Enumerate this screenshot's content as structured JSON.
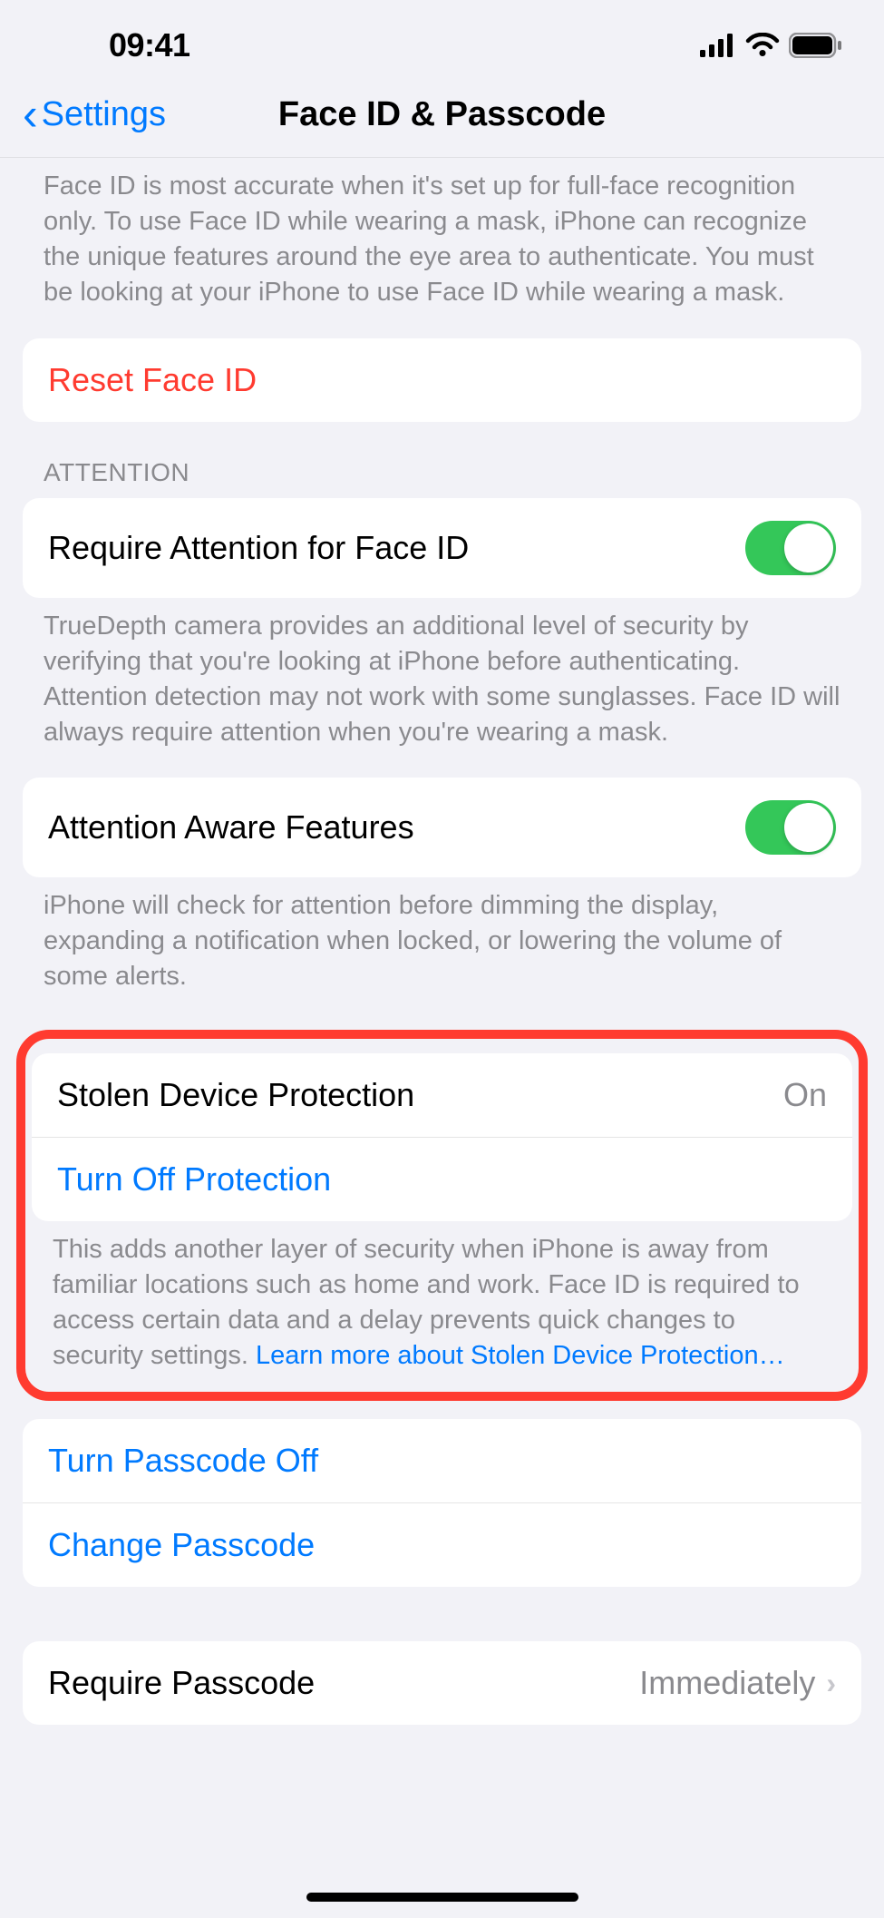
{
  "status": {
    "time": "09:41"
  },
  "nav": {
    "back_label": "Settings",
    "title": "Face ID & Passcode"
  },
  "faceid_mask_footer": "Face ID is most accurate when it's set up for full-face recognition only. To use Face ID while wearing a mask, iPhone can recognize the unique features around the eye area to authenticate. You must be looking at your iPhone to use Face ID while wearing a mask.",
  "reset_faceid": {
    "label": "Reset Face ID"
  },
  "attention": {
    "header": "ATTENTION",
    "require_label": "Require Attention for Face ID",
    "require_footer": "TrueDepth camera provides an additional level of security by verifying that you're looking at iPhone before authenticating. Attention detection may not work with some sunglasses. Face ID will always require attention when you're wearing a mask.",
    "aware_label": "Attention Aware Features",
    "aware_footer": "iPhone will check for attention before dimming the display, expanding a notification when locked, or lowering the volume of some alerts."
  },
  "stolen": {
    "label": "Stolen Device Protection",
    "value": "On",
    "turnoff_label": "Turn Off Protection",
    "footer_text": "This adds another layer of security when iPhone is away from familiar locations such as home and work. Face ID is required to access certain data and a delay prevents quick changes to security settings. ",
    "learn_more": "Learn more about Stolen Device Protection…"
  },
  "passcode": {
    "turnoff_label": "Turn Passcode Off",
    "change_label": "Change Passcode"
  },
  "require_passcode": {
    "label": "Require Passcode",
    "value": "Immediately"
  }
}
